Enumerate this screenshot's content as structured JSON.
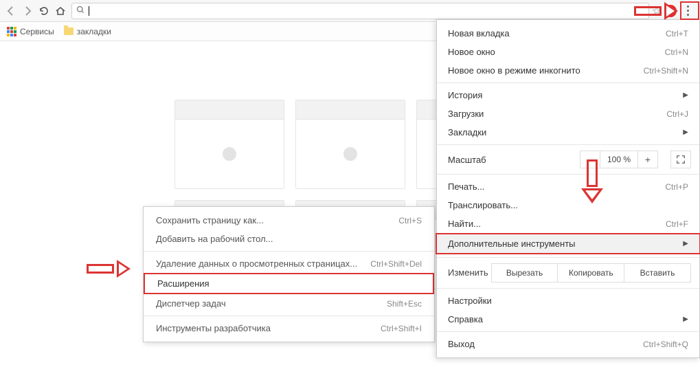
{
  "bookmarks_bar": {
    "apps_label": "Сервисы",
    "folder_label": "закладки"
  },
  "main_menu": {
    "new_tab": {
      "label": "Новая вкладка",
      "shortcut": "Ctrl+T"
    },
    "new_window": {
      "label": "Новое окно",
      "shortcut": "Ctrl+N"
    },
    "incognito": {
      "label": "Новое окно в режиме инкогнито",
      "shortcut": "Ctrl+Shift+N"
    },
    "history": {
      "label": "История"
    },
    "downloads": {
      "label": "Загрузки",
      "shortcut": "Ctrl+J"
    },
    "bookmarks": {
      "label": "Закладки"
    },
    "zoom": {
      "label": "Масштаб",
      "value": "100 %",
      "minus": "–",
      "plus": "+"
    },
    "print": {
      "label": "Печать...",
      "shortcut": "Ctrl+P"
    },
    "cast": {
      "label": "Транслировать..."
    },
    "find": {
      "label": "Найти...",
      "shortcut": "Ctrl+F"
    },
    "more_tools": {
      "label": "Дополнительные инструменты"
    },
    "edit": {
      "label": "Изменить",
      "cut": "Вырезать",
      "copy": "Копировать",
      "paste": "Вставить"
    },
    "settings": {
      "label": "Настройки"
    },
    "help": {
      "label": "Справка"
    },
    "exit": {
      "label": "Выход",
      "shortcut": "Ctrl+Shift+Q"
    }
  },
  "sub_menu": {
    "save_as": {
      "label": "Сохранить страницу как...",
      "shortcut": "Ctrl+S"
    },
    "add_to_desktop": {
      "label": "Добавить на рабочий стол..."
    },
    "clear_data": {
      "label": "Удаление данных о просмотренных страницах...",
      "shortcut": "Ctrl+Shift+Del"
    },
    "extensions": {
      "label": "Расширения"
    },
    "task_manager": {
      "label": "Диспетчер задач",
      "shortcut": "Shift+Esc"
    },
    "dev_tools": {
      "label": "Инструменты разработчика",
      "shortcut": "Ctrl+Shift+I"
    }
  }
}
